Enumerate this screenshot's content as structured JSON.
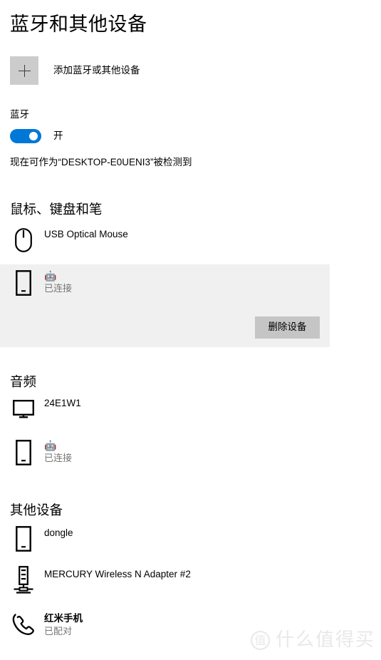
{
  "page": {
    "title": "蓝牙和其他设备"
  },
  "add_device": {
    "icon": "plus-icon",
    "label": "添加蓝牙或其他设备"
  },
  "bluetooth": {
    "label": "蓝牙",
    "toggle_state": "开",
    "toggle_on": true,
    "accent_color": "#0078D7",
    "discoverable_text": "现在可作为“DESKTOP-E0UENI3”被检测到"
  },
  "sections": [
    {
      "heading": "鼠标、键盘和笔",
      "devices": [
        {
          "icon": "mouse-icon",
          "name": "USB Optical Mouse",
          "status": "",
          "selected": false
        },
        {
          "icon": "smartphone-icon",
          "name": "🤖",
          "name_is_emoji": true,
          "status": "已连接",
          "selected": true,
          "action_label": "删除设备"
        }
      ]
    },
    {
      "heading": "音频",
      "devices": [
        {
          "icon": "monitor-icon",
          "name": "24E1W1",
          "status": "",
          "selected": false
        },
        {
          "icon": "smartphone-icon",
          "name": "🤖",
          "name_is_emoji": true,
          "status": "已连接",
          "selected": false
        }
      ]
    },
    {
      "heading": "其他设备",
      "devices": [
        {
          "icon": "smartphone-icon",
          "name": "dongle",
          "status": "",
          "selected": false
        },
        {
          "icon": "network-adapter-icon",
          "name": "MERCURY Wireless N Adapter #2",
          "status": "",
          "selected": false
        },
        {
          "icon": "phone-handset-icon",
          "name": "红米手机",
          "name_bold": true,
          "status": "已配对",
          "selected": false
        }
      ]
    }
  ],
  "watermark": {
    "badge": "值",
    "text": "什么值得买"
  }
}
